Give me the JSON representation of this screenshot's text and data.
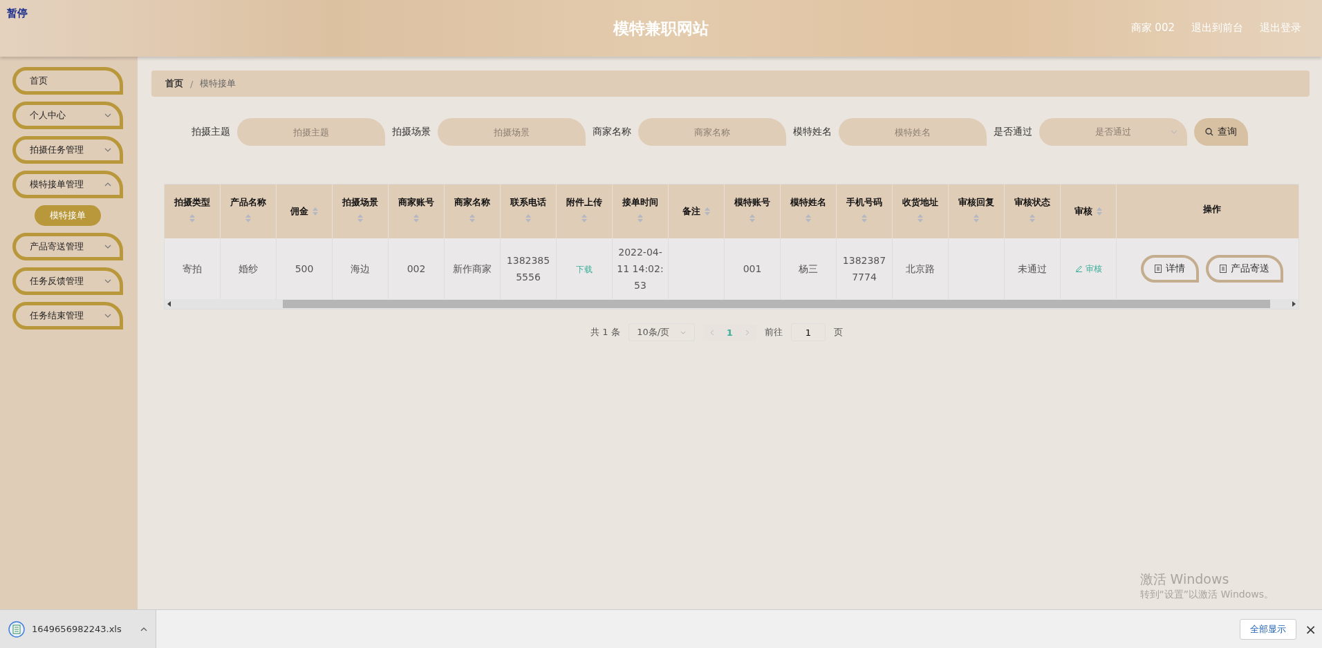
{
  "overlay_label": "暂停",
  "header": {
    "title": "模特兼职网站",
    "user": "商家 002",
    "links": [
      "退出到前台",
      "退出登录"
    ]
  },
  "sidebar": {
    "items": [
      {
        "label": "首页",
        "kind": "link",
        "selected": false
      },
      {
        "label": "个人中心",
        "kind": "submenu",
        "expanded": false,
        "selected": false
      },
      {
        "label": "拍摄任务管理",
        "kind": "submenu",
        "expanded": false,
        "selected": false
      },
      {
        "label": "模特接单管理",
        "kind": "submenu",
        "expanded": true,
        "selected": false,
        "children": [
          {
            "label": "模特接单",
            "selected": true
          }
        ]
      },
      {
        "label": "产品寄送管理",
        "kind": "submenu",
        "expanded": false,
        "selected": false
      },
      {
        "label": "任务反馈管理",
        "kind": "submenu",
        "expanded": false,
        "selected": false
      },
      {
        "label": "任务结束管理",
        "kind": "submenu",
        "expanded": false,
        "selected": false
      }
    ]
  },
  "breadcrumb": {
    "items": [
      "首页",
      "模特接单"
    ],
    "separator": "/"
  },
  "search": {
    "fields": [
      {
        "label": "拍摄主题",
        "placeholder": "拍摄主题",
        "kind": "input"
      },
      {
        "label": "拍摄场景",
        "placeholder": "拍摄场景",
        "kind": "input"
      },
      {
        "label": "商家名称",
        "placeholder": "商家名称",
        "kind": "input"
      },
      {
        "label": "模特姓名",
        "placeholder": "模特姓名",
        "kind": "input"
      },
      {
        "label": "是否通过",
        "placeholder": "是否通过",
        "kind": "select"
      }
    ],
    "button": "查询"
  },
  "table": {
    "columns": [
      {
        "label": "拍摄类型",
        "sortable": true
      },
      {
        "label": "产品名称",
        "sortable": true
      },
      {
        "label": "佣金",
        "sortable": true,
        "inline_sort": true
      },
      {
        "label": "拍摄场景",
        "sortable": true
      },
      {
        "label": "商家账号",
        "sortable": true
      },
      {
        "label": "商家名称",
        "sortable": true
      },
      {
        "label": "联系电话",
        "sortable": true
      },
      {
        "label": "附件上传",
        "sortable": true
      },
      {
        "label": "接单时间",
        "sortable": true
      },
      {
        "label": "备注",
        "sortable": true,
        "inline_sort": true
      },
      {
        "label": "模特账号",
        "sortable": true
      },
      {
        "label": "模特姓名",
        "sortable": true
      },
      {
        "label": "手机号码",
        "sortable": true
      },
      {
        "label": "收货地址",
        "sortable": true
      },
      {
        "label": "审核回复",
        "sortable": true
      },
      {
        "label": "审核状态",
        "sortable": true
      },
      {
        "label": "审核",
        "sortable": true,
        "inline_sort": true
      },
      {
        "label": "操作",
        "sortable": false,
        "kind": "actions"
      }
    ],
    "rows": [
      {
        "cells": [
          {
            "kind": "text",
            "text": "寄拍"
          },
          {
            "kind": "text",
            "text": "婚纱"
          },
          {
            "kind": "text",
            "text": "500"
          },
          {
            "kind": "text",
            "text": "海边"
          },
          {
            "kind": "text",
            "text": "002"
          },
          {
            "kind": "text",
            "text": "新作商家"
          },
          {
            "kind": "text",
            "text": "13823855556"
          },
          {
            "kind": "link",
            "text": "下载"
          },
          {
            "kind": "text",
            "text": "2022-04-11 14:02:53"
          },
          {
            "kind": "text"
          },
          {
            "kind": "text",
            "text": "001"
          },
          {
            "kind": "text",
            "text": "杨三"
          },
          {
            "kind": "text",
            "text": "13823877774"
          },
          {
            "kind": "text",
            "text": "北京路"
          },
          {
            "kind": "text"
          },
          {
            "kind": "text",
            "text": "未通过"
          },
          {
            "kind": "audit",
            "text": "审核"
          },
          {
            "kind": "actions",
            "buttons": [
              "详情",
              "产品寄送"
            ]
          }
        ]
      }
    ]
  },
  "pagination": {
    "total": "共 1 条",
    "page_size": "10条/页",
    "pages": [
      {
        "label": "1",
        "selected": true
      }
    ],
    "goto_label": "前往",
    "goto_value": "1",
    "goto_suffix": "页"
  },
  "windows_notice": {
    "title": "激活 Windows",
    "text": "转到“设置”以激活 Windows。"
  },
  "download_bar": {
    "file": "1649656982243.xls",
    "show_all": "全部显示",
    "close": "×"
  }
}
